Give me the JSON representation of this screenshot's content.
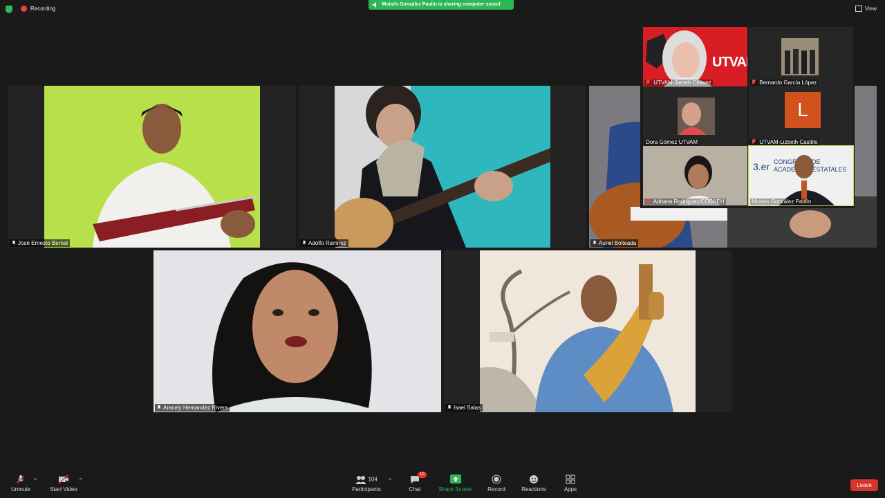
{
  "topbar": {
    "recording": "Recording",
    "share_banner": "Moisés González Paulín is sharing computer sound",
    "view": "View"
  },
  "main_tiles": [
    {
      "name": "José Ernesto Bernal"
    },
    {
      "name": "Adolfo Ramirez"
    },
    {
      "name": "Auriel Bolteada"
    },
    {
      "name": "Aracely Hernandez Rivera"
    },
    {
      "name": "Isael Salas"
    }
  ],
  "gallery": [
    {
      "name": "UTVAM-Janeth Chavez",
      "muted": true,
      "logo": "UTVAM"
    },
    {
      "name": "Bernardo García López",
      "muted": true
    },
    {
      "name": "Dora Gómez UTVAM",
      "muted": false
    },
    {
      "name": "UTVAM-Lizbeth Castillo",
      "muted": true,
      "avatar": "L"
    },
    {
      "name": "Adriana Rodríguez/COBAEH",
      "muted": true
    },
    {
      "name": "Moisés González Paulín",
      "muted": false,
      "slide_text": "CONGRESO DE ACADEMIAS ESTATALES",
      "slide_num": "3.er"
    }
  ],
  "toolbar": {
    "unmute": "Unmute",
    "start_video": "Start Video",
    "participants": "Participants",
    "participants_count": "104",
    "chat": "Chat",
    "chat_badge": "10",
    "share_screen": "Share Screen",
    "record": "Record",
    "reactions": "Reactions",
    "apps": "Apps",
    "leave": "Leave"
  },
  "colors": {
    "accent_green": "#2db855",
    "leave_red": "#d9342b",
    "avatar_orange": "#d2521e"
  }
}
